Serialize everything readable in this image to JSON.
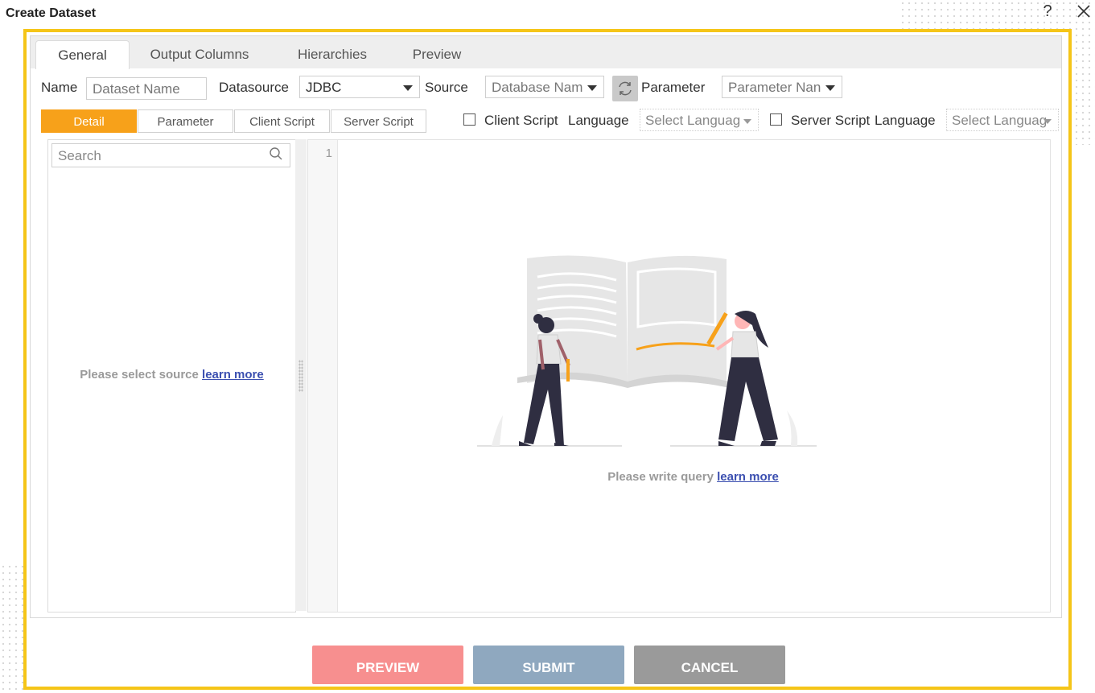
{
  "dialog": {
    "title": "Create Dataset",
    "help_label": "?"
  },
  "tabs": [
    {
      "label": "General",
      "active": true
    },
    {
      "label": "Output Columns",
      "active": false
    },
    {
      "label": "Hierarchies",
      "active": false
    },
    {
      "label": "Preview",
      "active": false
    }
  ],
  "form": {
    "name_label": "Name",
    "name_placeholder": "Dataset Name",
    "datasource_label": "Datasource",
    "datasource_value": "JDBC",
    "source_label": "Source",
    "source_placeholder": "Database Nam",
    "parameter_label": "Parameter",
    "parameter_placeholder": "Parameter Nan"
  },
  "subtabs": [
    {
      "label": "Detail",
      "active": true
    },
    {
      "label": "Parameter",
      "active": false
    },
    {
      "label": "Client Script",
      "active": false
    },
    {
      "label": "Server Script",
      "active": false
    }
  ],
  "script_options": {
    "client_script_label": "Client Script",
    "client_language_label": "Language",
    "client_language_placeholder": "Select Languag",
    "server_script_label": "Server Script",
    "server_language_label": "Language",
    "server_language_placeholder": "Select Languag"
  },
  "left_panel": {
    "search_placeholder": "Search",
    "empty_text": "Please select source",
    "empty_link": "learn more"
  },
  "editor": {
    "line_number": "1",
    "empty_text": "Please write query",
    "empty_link": "learn more"
  },
  "buttons": {
    "preview": "PREVIEW",
    "submit": "SUBMIT",
    "cancel": "CANCEL"
  },
  "colors": {
    "frame_border": "#f5c518",
    "accent_orange": "#f7a11a",
    "preview_button": "#f78f8f",
    "submit_button": "#8fa8bf",
    "cancel_button": "#9a9a9a",
    "link": "#3b4fb0"
  },
  "icons": [
    "help-icon",
    "close-icon",
    "dropdown-caret-icon",
    "refresh-icon",
    "search-icon",
    "book-illustration"
  ]
}
